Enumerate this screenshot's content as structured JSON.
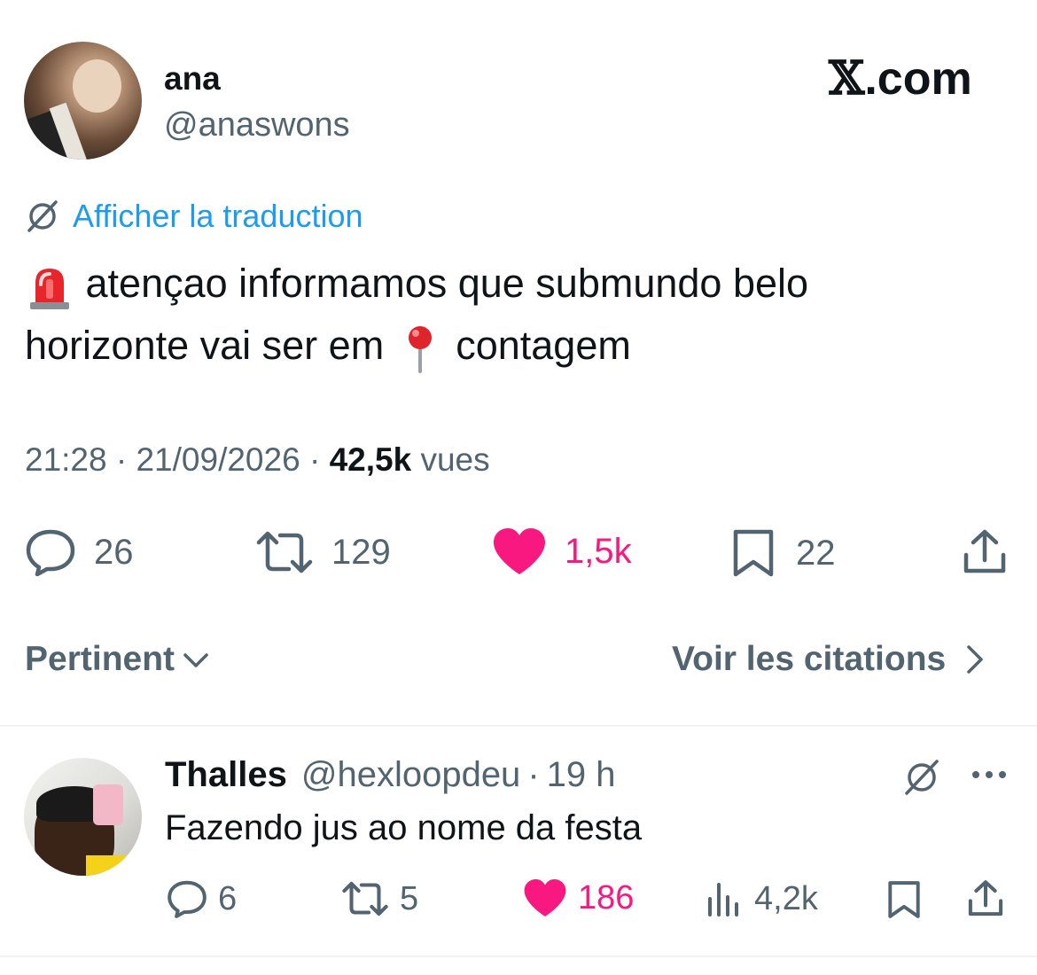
{
  "author": {
    "name": "ana",
    "handle": "@anaswons"
  },
  "site_logo": {
    "glyph": "𝕏",
    "text": ".com"
  },
  "translate": {
    "label": "Afficher la traduction"
  },
  "tweet": {
    "line1": "atençao informamos que submundo belo",
    "line2a": "horizonte vai ser em",
    "line2b": "contagem",
    "emoji1": "siren-emoji",
    "emoji2": "pushpin-emoji"
  },
  "meta": {
    "time": "21:28",
    "sep1": "·",
    "date": "21/09/2026",
    "sep2": "·",
    "views_count": "42,5k",
    "views_label": "vues"
  },
  "actions": {
    "replies": "26",
    "retweets": "129",
    "likes": "1,5k",
    "bookmarks": "22"
  },
  "sort": {
    "label": "Pertinent",
    "quotes_label": "Voir les citations"
  },
  "reply": {
    "name": "Thalles",
    "handle": "@hexloopdeu",
    "sep": "·",
    "time": "19 h",
    "text": "Fazendo jus ao nome da festa",
    "replies": "6",
    "retweets": "5",
    "likes": "186",
    "views": "4,2k"
  },
  "colors": {
    "link": "#1d9bf0",
    "like": "#f91880",
    "muted": "#536471",
    "text": "#0f1419"
  }
}
